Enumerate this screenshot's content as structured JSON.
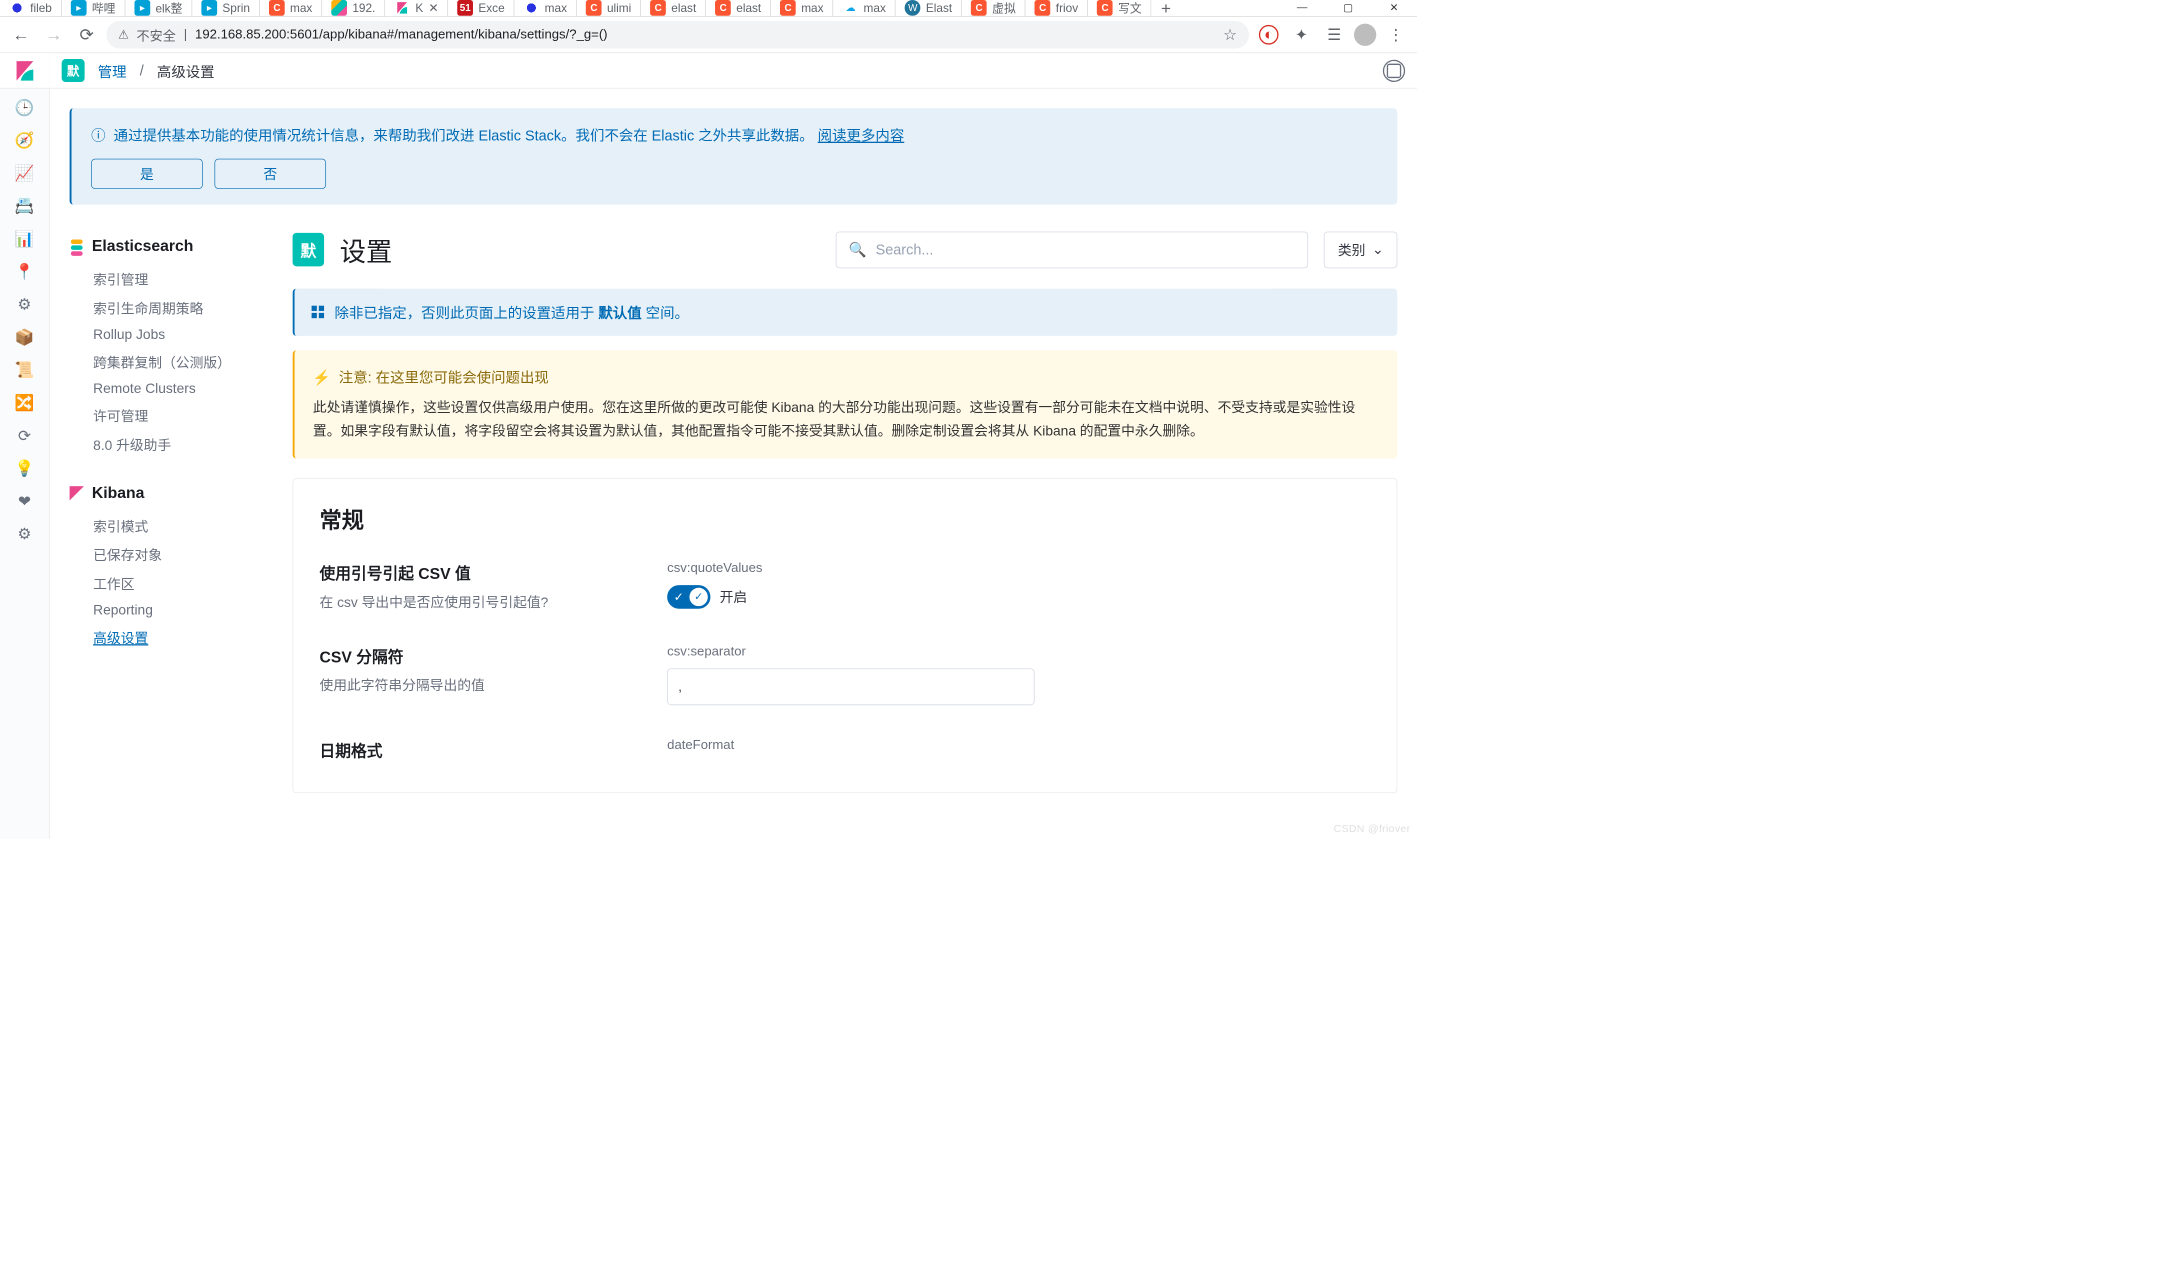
{
  "browser": {
    "tabs": [
      {
        "icon": "baidu",
        "label": "fileb"
      },
      {
        "icon": "bili",
        "label": "哔哩"
      },
      {
        "icon": "bili",
        "label": "elk整"
      },
      {
        "icon": "bili",
        "label": "Sprin"
      },
      {
        "icon": "csdn",
        "label": "max"
      },
      {
        "icon": "es",
        "label": "192."
      },
      {
        "icon": "kibana",
        "label": "K",
        "active": true
      },
      {
        "icon": "cto",
        "label": "Exce"
      },
      {
        "icon": "baidu",
        "label": "max"
      },
      {
        "icon": "csdn",
        "label": "ulimi"
      },
      {
        "icon": "csdn",
        "label": "elast"
      },
      {
        "icon": "csdn",
        "label": "elast"
      },
      {
        "icon": "csdn",
        "label": "max"
      },
      {
        "icon": "cloud",
        "label": "max"
      },
      {
        "icon": "wp",
        "label": "Elast"
      },
      {
        "icon": "csdn",
        "label": "虚拟"
      },
      {
        "icon": "csdn",
        "label": "friov"
      },
      {
        "icon": "csdn",
        "label": "写文"
      }
    ],
    "insecure": "不安全",
    "url": "192.168.85.200:5601/app/kibana#/management/kibana/settings/?_g=()"
  },
  "rail": [
    "🕒",
    "🧭",
    "📈",
    "📇",
    "📊",
    "📍",
    "⚙",
    "📦",
    "📜",
    "🔀",
    "⟳",
    "💡",
    "❤",
    "⚙"
  ],
  "topbar": {
    "badge": "默",
    "crumb1": "管理",
    "sep": "/",
    "crumb2": "高级设置"
  },
  "telemetry": {
    "text": "通过提供基本功能的使用情况统计信息，来帮助我们改进 Elastic Stack。我们不会在 Elastic 之外共享此数据。",
    "link": "阅读更多内容",
    "yes": "是",
    "no": "否"
  },
  "mgmtnav": {
    "g1": {
      "title": "Elasticsearch",
      "items": [
        "索引管理",
        "索引生命周期策略",
        "Rollup Jobs",
        "跨集群复制（公测版）",
        "Remote Clusters",
        "许可管理",
        "8.0 升级助手"
      ]
    },
    "g2": {
      "title": "Kibana",
      "items": [
        "索引模式",
        "已保存对象",
        "工作区",
        "Reporting",
        "高级设置"
      ],
      "activeIndex": 4
    }
  },
  "settings": {
    "badge": "默",
    "title": "设置",
    "search_ph": "Search...",
    "category": "类别",
    "info_pre": "除非已指定，否则此页面上的设置适用于 ",
    "info_bold": "默认值",
    "info_post": " 空间。",
    "warn_title": "注意:  在这里您可能会使问题出现",
    "warn_body": "此处请谨慎操作，这些设置仅供高级用户使用。您在这里所做的更改可能使 Kibana 的大部分功能出现问题。这些设置有一部分可能未在文档中说明、不受支持或是实验性设置。如果字段有默认值，将字段留空会将其设置为默认值，其他配置指令可能不接受其默认值。删除定制设置会将其从 Kibana 的配置中永久删除。",
    "section": "常规",
    "r1": {
      "t": "使用引号引起 CSV 值",
      "d": "在 csv 导出中是否应使用引号引起值?",
      "k": "csv:quoteValues",
      "on": "开启"
    },
    "r2": {
      "t": "CSV 分隔符",
      "d": "使用此字符串分隔导出的值",
      "k": "csv:separator",
      "v": ","
    },
    "r3": {
      "t": "日期格式",
      "k": "dateFormat"
    }
  },
  "watermark": "CSDN @friover"
}
